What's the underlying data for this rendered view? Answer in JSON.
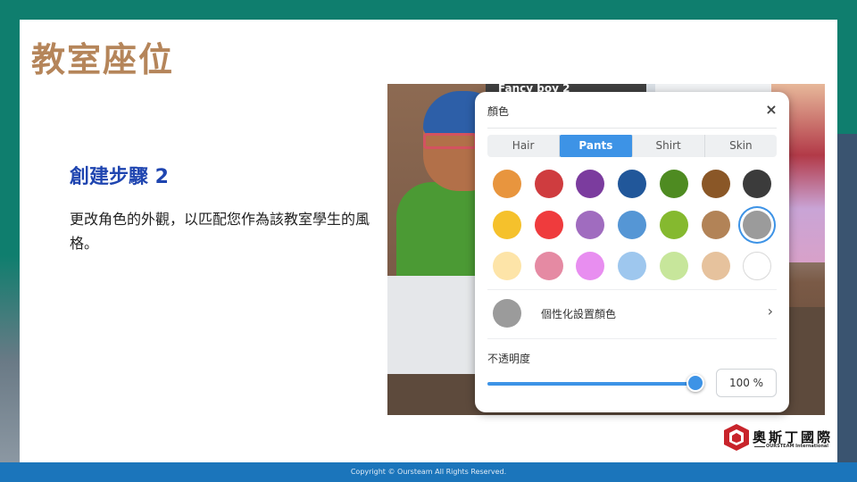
{
  "slide": {
    "title": "教室座位",
    "step_heading": "創建步驟 2",
    "step_description": "更改角色的外觀，以匹配您作為該教室學生的風格。",
    "footer": "Copyright © Oursteam All Rights Reserved."
  },
  "scene": {
    "name_label": "Fancy boy 2"
  },
  "color_panel": {
    "title": "顏色",
    "close_icon": "×",
    "tabs": [
      {
        "label": "Hair",
        "active": false
      },
      {
        "label": "Pants",
        "active": true
      },
      {
        "label": "Shirt",
        "active": false
      },
      {
        "label": "Skin",
        "active": false
      }
    ],
    "swatch_rows": [
      [
        "#e8953e",
        "#cf3c3f",
        "#7b3c9e",
        "#21579a",
        "#4e8b21",
        "#8a5727",
        "#3b3b3b"
      ],
      [
        "#f5c12c",
        "#ef3b3d",
        "#a06cbf",
        "#5596d5",
        "#85b92f",
        "#b28357",
        "#9b9b9b"
      ],
      [
        "#fde4a8",
        "#e58aa3",
        "#e88ef0",
        "#9ec7ee",
        "#c7e69b",
        "#e6c29d",
        "#ffffff"
      ]
    ],
    "selected_swatch": "#9b9b9b",
    "custom_color": {
      "label": "個性化設置顏色",
      "swatch": "#9b9b9b",
      "chevron": "›"
    },
    "opacity": {
      "label": "不透明度",
      "value_percent": 100,
      "display": "100 %"
    },
    "accent": "#3d93e6"
  },
  "logo": {
    "name_cn": "奧斯丁國際",
    "name_en": "OURSTEAM International",
    "brand_red": "#c8242b"
  }
}
